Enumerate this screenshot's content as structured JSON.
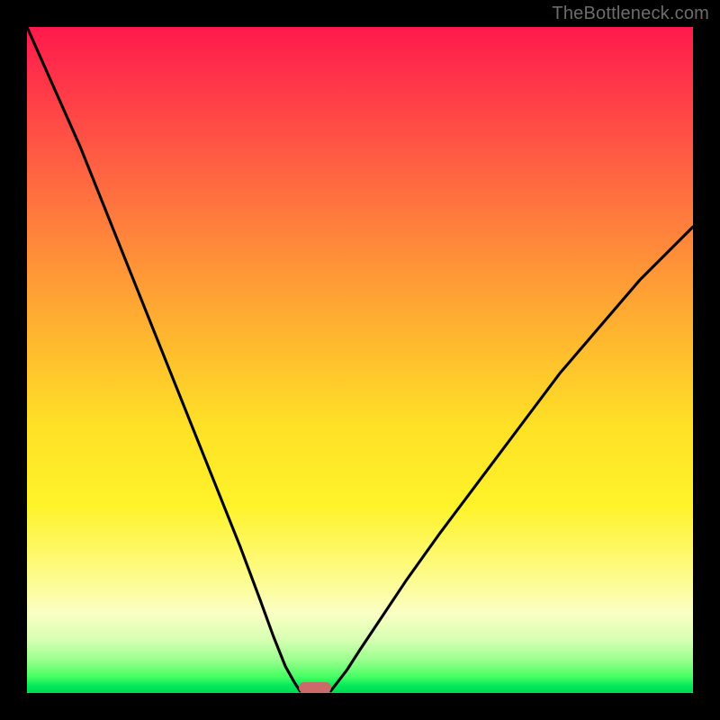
{
  "watermark": "TheBottleneck.com",
  "chart_data": {
    "type": "line",
    "title": "",
    "xlabel": "",
    "ylabel": "",
    "xlim": [
      0,
      100
    ],
    "ylim": [
      0,
      100
    ],
    "grid": false,
    "legend": false,
    "background_gradient": {
      "type": "vertical",
      "stops": [
        {
          "pos": 0.0,
          "color": "#ff1a4b"
        },
        {
          "pos": 0.18,
          "color": "#ff5744"
        },
        {
          "pos": 0.33,
          "color": "#ff8a3a"
        },
        {
          "pos": 0.47,
          "color": "#ffb82e"
        },
        {
          "pos": 0.6,
          "color": "#ffe126"
        },
        {
          "pos": 0.72,
          "color": "#fff32a"
        },
        {
          "pos": 0.82,
          "color": "#fdfb86"
        },
        {
          "pos": 0.92,
          "color": "#d7ffb3"
        },
        {
          "pos": 0.97,
          "color": "#4aff64"
        },
        {
          "pos": 1.0,
          "color": "#00d853"
        }
      ]
    },
    "series": [
      {
        "name": "left-branch",
        "x": [
          0,
          4,
          8,
          12,
          16,
          20,
          24,
          28,
          32,
          35,
          37,
          38.8,
          40.2,
          41.0
        ],
        "y": [
          100,
          91,
          82,
          72,
          62,
          52,
          42,
          32,
          22,
          14,
          8.5,
          4.0,
          1.5,
          0.3
        ]
      },
      {
        "name": "right-branch",
        "x": [
          45.6,
          46.3,
          48,
          50,
          53,
          57,
          62,
          68,
          74,
          80,
          86,
          92,
          98,
          100
        ],
        "y": [
          0.3,
          1.2,
          3.4,
          6.5,
          11,
          17,
          24,
          32,
          40,
          48,
          55,
          62,
          68,
          70
        ]
      }
    ],
    "marker": {
      "x": 43.2,
      "y": 0,
      "color": "#cc6a6b",
      "shape": "pill"
    },
    "plot_frame": {
      "border_color": "#000000",
      "border_px": 30
    }
  }
}
